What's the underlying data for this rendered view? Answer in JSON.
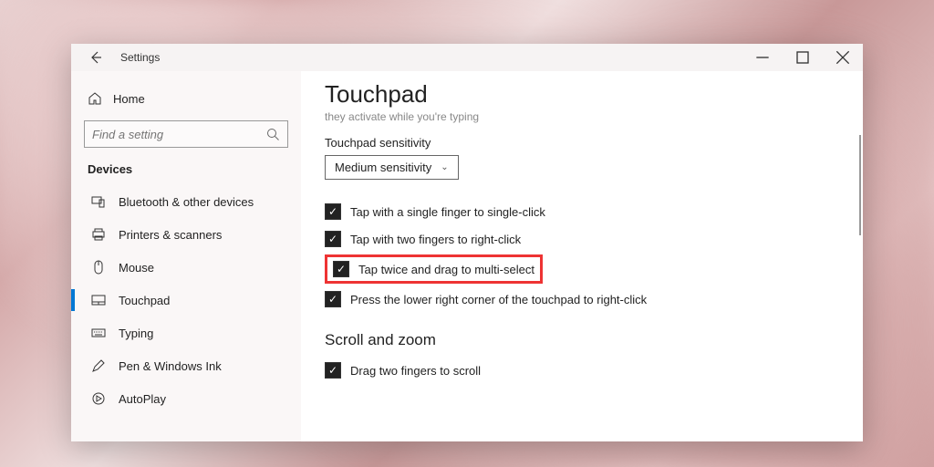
{
  "titlebar": {
    "title": "Settings"
  },
  "sidebar": {
    "home": "Home",
    "search_placeholder": "Find a setting",
    "section": "Devices",
    "items": [
      {
        "label": "Bluetooth & other devices"
      },
      {
        "label": "Printers & scanners"
      },
      {
        "label": "Mouse"
      },
      {
        "label": "Touchpad"
      },
      {
        "label": "Typing"
      },
      {
        "label": "Pen & Windows Ink"
      },
      {
        "label": "AutoPlay"
      }
    ]
  },
  "content": {
    "title": "Touchpad",
    "truncated_prev": "they activate while you're typing",
    "sensitivity_label": "Touchpad sensitivity",
    "sensitivity_value": "Medium sensitivity",
    "checks": [
      "Tap with a single finger to single-click",
      "Tap with two fingers to right-click",
      "Tap twice and drag to multi-select",
      "Press the lower right corner of the touchpad to right-click"
    ],
    "scroll_head": "Scroll and zoom",
    "scroll_check": "Drag two fingers to scroll"
  }
}
